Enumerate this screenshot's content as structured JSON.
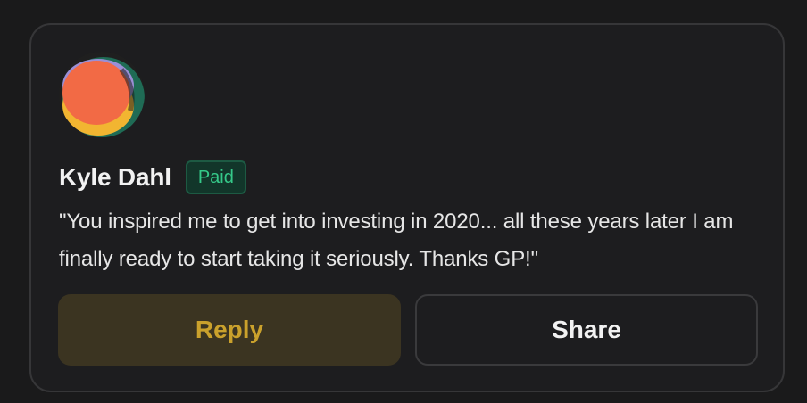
{
  "comment_card": {
    "author": {
      "name": "Kyle Dahl",
      "badge": "Paid"
    },
    "text": "\"You inspired me to get into investing in 2020... all these years later I am finally ready to start taking it seriously. Thanks GP!\"",
    "actions": {
      "reply_label": "Reply",
      "share_label": "Share"
    }
  },
  "colors": {
    "background": "#1a1a1b",
    "card_border": "#363638",
    "badge_text": "#35c989",
    "reply_bg": "#3b3421",
    "reply_text": "#caa12c"
  },
  "icons": {
    "avatar": "abstract-orange-avatar"
  }
}
